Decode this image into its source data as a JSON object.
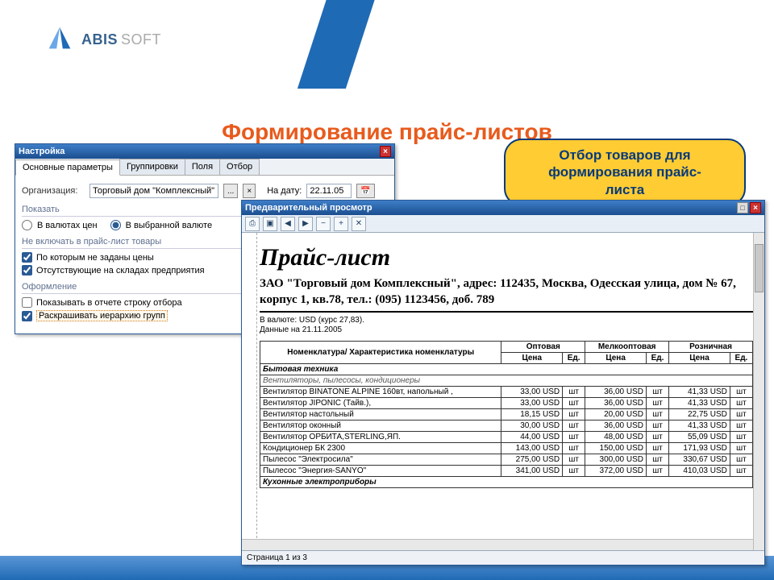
{
  "brand": {
    "name": "ABIS",
    "suffix": "SOFT"
  },
  "page_title": "Формирование прайс-листов",
  "callout": {
    "line1": "Отбор товаров для",
    "line2": "формирования прайс-",
    "line3": "листа"
  },
  "settings_window": {
    "title": "Настройка",
    "tabs": [
      "Основные параметры",
      "Группировки",
      "Поля",
      "Отбор"
    ],
    "org_label": "Организация:",
    "org_value": "Торговый дом \"Комплексный\"",
    "ellipsis": "...",
    "clear": "×",
    "date_label": "На дату:",
    "date_value": "22.11.05",
    "show_label": "Показать",
    "radio1": "В валютах цен",
    "radio2": "В выбранной валюте",
    "exclude_label": "Не включать в прайс-лист товары",
    "chk_noprice": "По которым не заданы цены",
    "chk_nostock": "Отсутствующие на складах предприятия",
    "design_label": "Оформление",
    "chk_showfilter": "Показывать в отчете строку отбора",
    "chk_colorize": "Раскрашивать иерархию групп"
  },
  "preview_window": {
    "title": "Предварительный просмотр",
    "status": "Страница 1 из 3",
    "doc_title": "Прайс-лист",
    "address": "ЗАО \"Торговый дом Комплексный\", адрес: 112435, Москва, Одесская улица, дом № 67, корпус 1, кв.78, тел.: (095) 1123456, доб. 789",
    "currency_line": "В валюте: USD (курс 27,83).",
    "date_line": "Данные на 21.11.2005",
    "col_name": "Номенклатура/ Характеристика номенклатуры",
    "price_groups": [
      "Оптовая",
      "Мелкооптовая",
      "Розничная"
    ],
    "col_price": "Цена",
    "col_unit": "Ед.",
    "groups": [
      {
        "name": "Бытовая техника",
        "sub": "Вентиляторы, пылесосы, кондиционеры",
        "rows": [
          {
            "n": "Вентилятор BINATONE ALPINE 160вт, напольный ,",
            "p": [
              "33,00 USD",
              "36,00 USD",
              "41,33 USD"
            ],
            "u": "шт"
          },
          {
            "n": "Вентилятор JIPONIC (Тайв.),",
            "p": [
              "33,00 USD",
              "36,00 USD",
              "41,33 USD"
            ],
            "u": "шт"
          },
          {
            "n": "Вентилятор настольный",
            "p": [
              "18,15 USD",
              "20,00 USD",
              "22,75 USD"
            ],
            "u": "шт"
          },
          {
            "n": "Вентилятор оконный",
            "p": [
              "30,00 USD",
              "36,00 USD",
              "41,33 USD"
            ],
            "u": "шт"
          },
          {
            "n": "Вентилятор ОРБИТА,STERLING,ЯП.",
            "p": [
              "44,00 USD",
              "48,00 USD",
              "55,09 USD"
            ],
            "u": "шт"
          },
          {
            "n": "Кондиционер БК 2300",
            "p": [
              "143,00 USD",
              "150,00 USD",
              "171,93 USD"
            ],
            "u": "шт"
          },
          {
            "n": "Пылесос \"Электросила\"",
            "p": [
              "275,00 USD",
              "300,00 USD",
              "330,67 USD"
            ],
            "u": "шт"
          },
          {
            "n": "Пылесос \"Энергия-SANYO\"",
            "p": [
              "341,00 USD",
              "372,00 USD",
              "410,03 USD"
            ],
            "u": "шт"
          }
        ]
      },
      {
        "name": "Кухонные электроприборы",
        "sub": "",
        "rows": []
      }
    ]
  }
}
